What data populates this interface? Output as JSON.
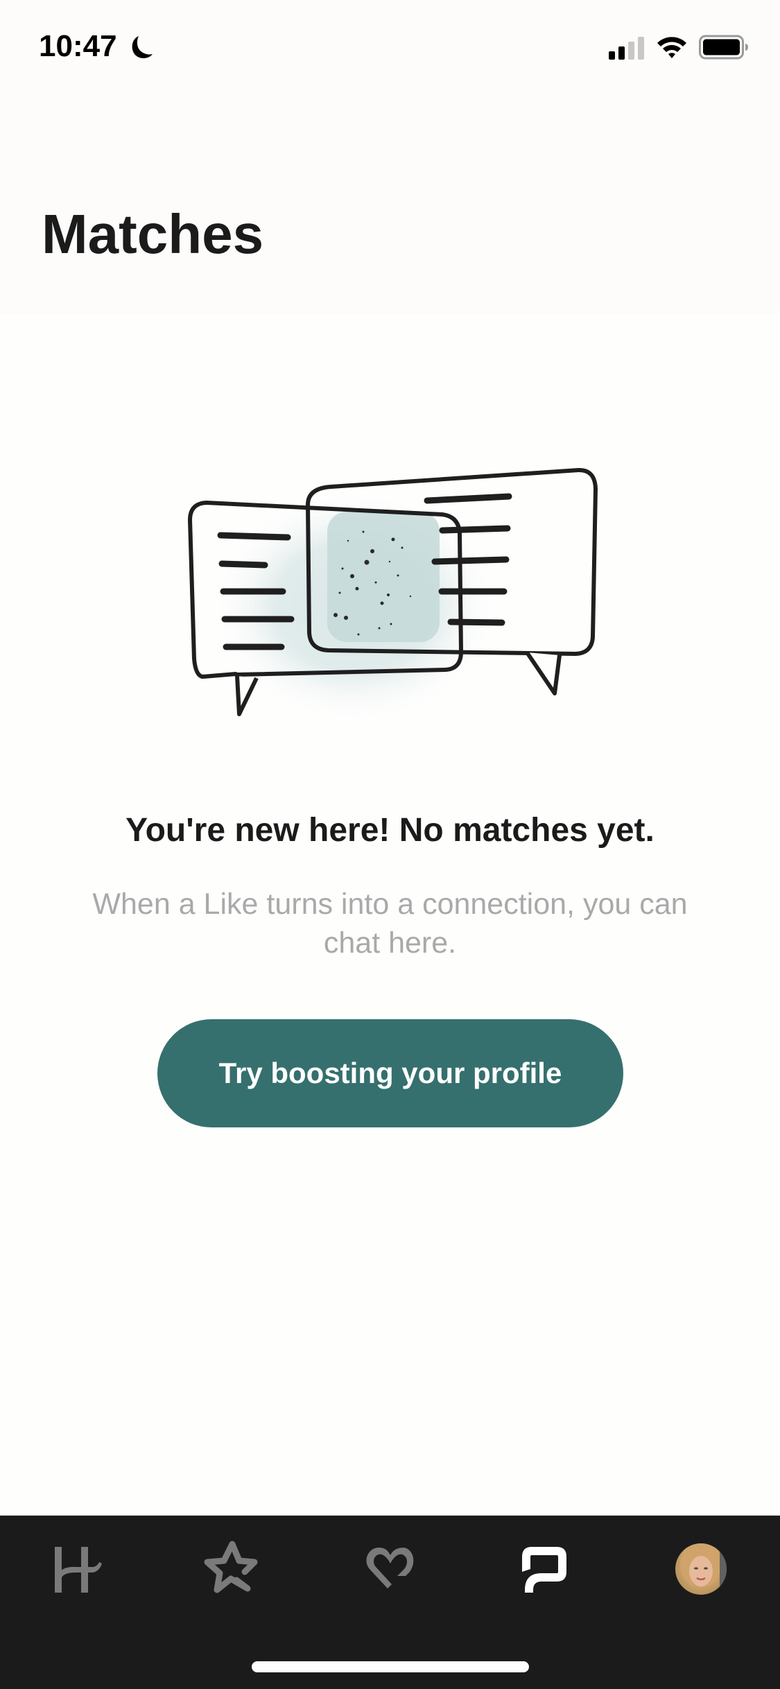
{
  "status_bar": {
    "time": "10:47",
    "focus_icon": "moon-icon",
    "signal_icon": "cellular-signal-icon",
    "wifi_icon": "wifi-icon",
    "battery_icon": "battery-icon"
  },
  "header": {
    "title": "Matches"
  },
  "empty_state": {
    "illustration": "chat-bubbles-illustration",
    "title": "You're new here! No matches yet.",
    "description": "When a Like turns into a connection, you can chat here.",
    "cta_label": "Try boosting your profile"
  },
  "colors": {
    "accent": "#35706e",
    "tab_bar_bg": "#1b1b1b",
    "tab_inactive": "#7a7a7a",
    "tab_active": "#ffffff",
    "description_text": "#a9a9a9"
  },
  "tab_bar": {
    "items": [
      {
        "name": "discover",
        "icon": "hinge-logo-icon",
        "active": false
      },
      {
        "name": "standouts",
        "icon": "star-icon",
        "active": false
      },
      {
        "name": "likes-you",
        "icon": "heart-icon",
        "active": false
      },
      {
        "name": "matches",
        "icon": "chat-bubble-icon",
        "active": true
      },
      {
        "name": "profile",
        "icon": "avatar",
        "active": false
      }
    ]
  }
}
